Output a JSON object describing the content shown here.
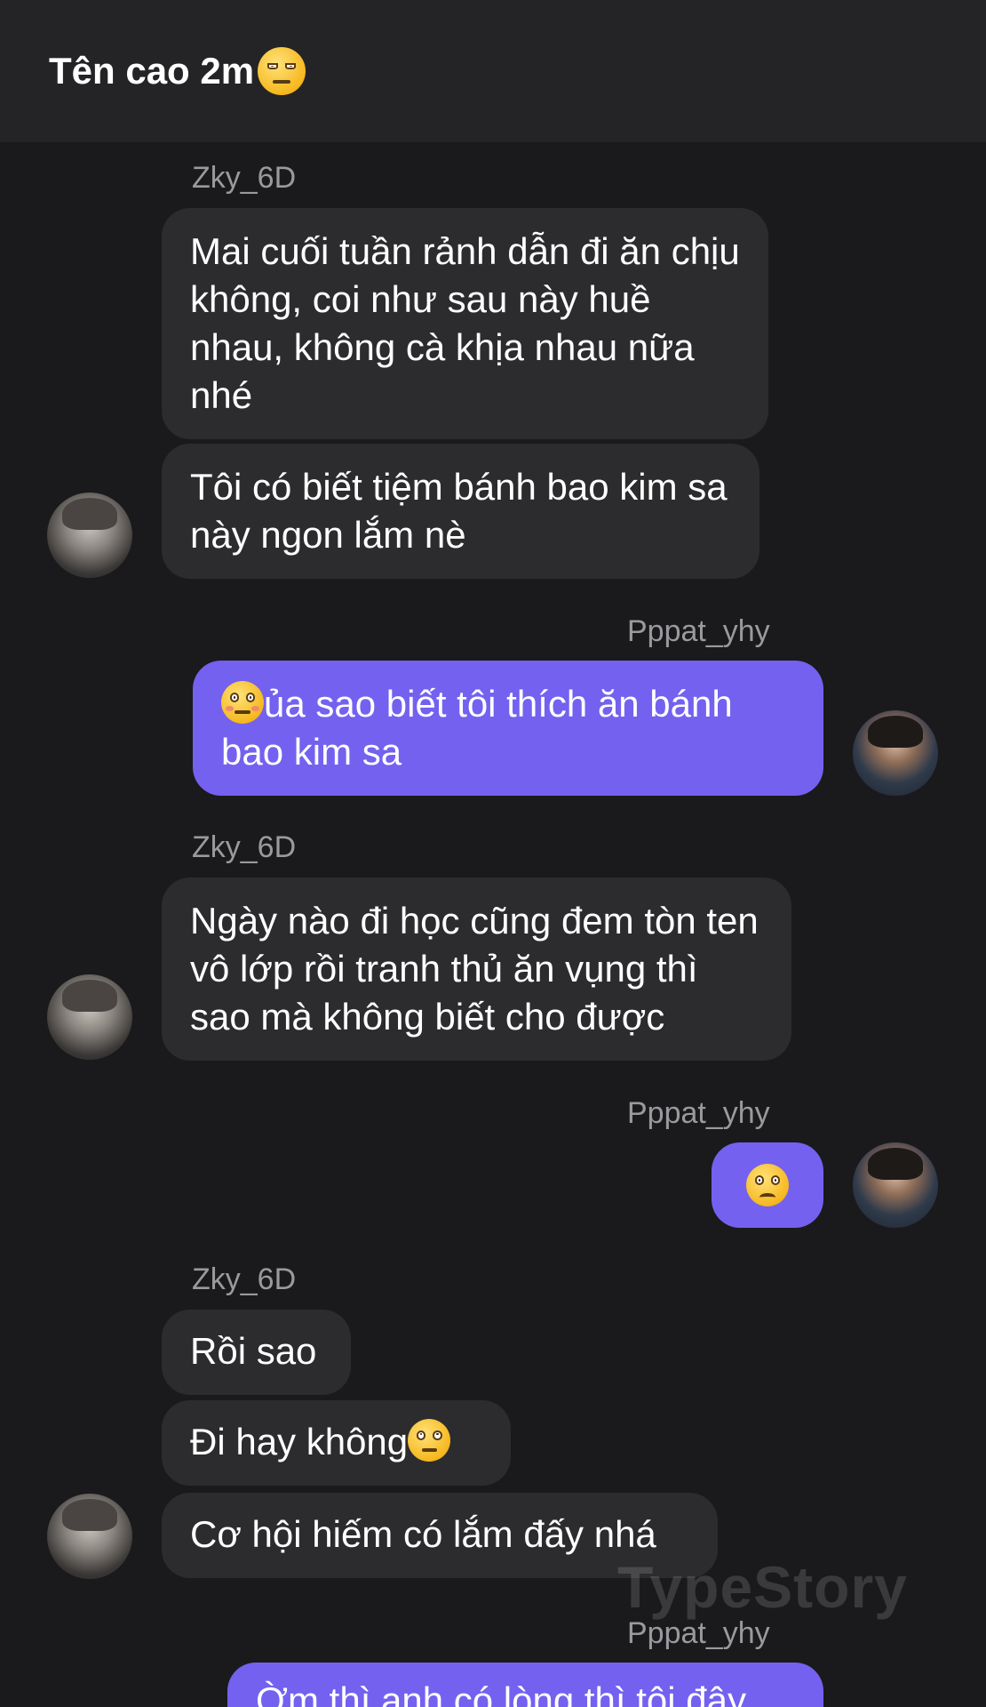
{
  "header": {
    "title": "Tên cao 2m",
    "title_emoji": "unamused-face-emoji"
  },
  "senders": {
    "left": "Zky_6D",
    "right": "Pppat_yhy"
  },
  "messages": [
    {
      "side": "left",
      "text": "Mai cuối tuần rảnh dẫn đi ăn chịu không, coi như sau này huề nhau, không cà khịa nhau nữa nhé"
    },
    {
      "side": "left",
      "text": "Tôi có biết tiệm bánh bao kim sa này ngon lắm nè"
    },
    {
      "side": "right",
      "text": "ủa sao biết tôi thích ăn bánh bao kim sa",
      "emoji": "flushed-face-emoji"
    },
    {
      "side": "left",
      "text": "Ngày nào đi học cũng đem tòn ten vô lớp rồi tranh thủ ăn vụng thì sao mà không biết cho được"
    },
    {
      "side": "right",
      "text": "",
      "emoji": "slightly-frowning-face-emoji"
    },
    {
      "side": "left",
      "text": "Rồi sao"
    },
    {
      "side": "left",
      "text": "Đi hay không",
      "emoji": "face-with-rolling-eyes-emoji"
    },
    {
      "side": "left",
      "text": "Cơ hội hiếm có lắm đấy nhá"
    },
    {
      "side": "right",
      "text": "Ờm thì anh có lòng thì tôi đây"
    }
  ],
  "watermark": "TypeStory",
  "colors": {
    "background": "#1a1a1c",
    "header": "#242426",
    "incoming_bubble": "#2c2c2e",
    "outgoing_bubble": "#7461f0",
    "sender_name": "#9a9a9e"
  }
}
